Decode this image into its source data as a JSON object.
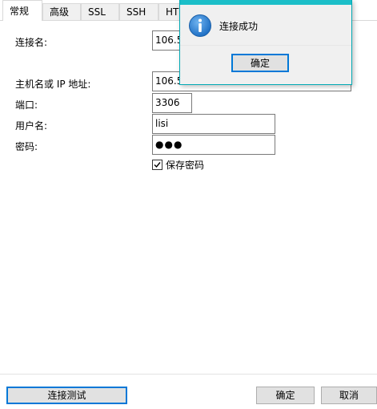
{
  "tabs": [
    {
      "label": "常规",
      "active": true
    },
    {
      "label": "高级",
      "active": false
    },
    {
      "label": "SSL",
      "active": false
    },
    {
      "label": "SSH",
      "active": false
    },
    {
      "label": "HT",
      "active": false
    }
  ],
  "form": {
    "connection_name": {
      "label": "连接名:",
      "value": "106.5"
    },
    "host": {
      "label": "主机名或 IP 地址:",
      "value": "106.5"
    },
    "port": {
      "label": "端口:",
      "value": "3306"
    },
    "username": {
      "label": "用户名:",
      "value": "lisi"
    },
    "password": {
      "label": "密码:",
      "value": "●●●"
    },
    "save_password": {
      "label": "保存密码",
      "checked": true
    }
  },
  "footer": {
    "test_label": "连接测试",
    "ok_label": "确定",
    "cancel_label": "取消"
  },
  "dialog": {
    "message": "连接成功",
    "ok_label": "确定",
    "icon": "info-icon"
  },
  "colors": {
    "accent": "#0078d7",
    "dialog_title": "#1bbec8",
    "info_icon": "#1e6fc4"
  }
}
